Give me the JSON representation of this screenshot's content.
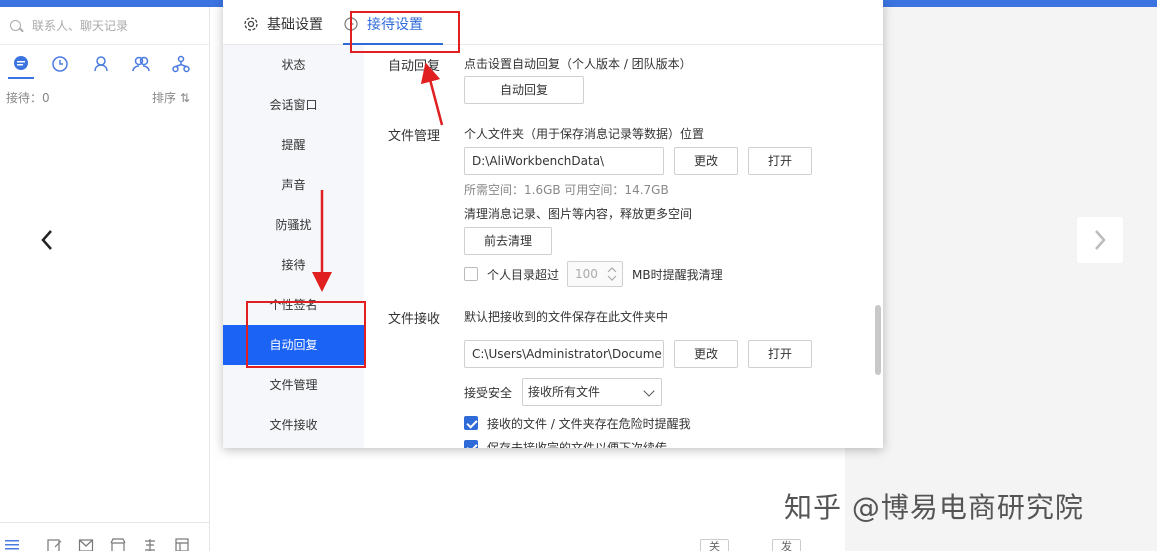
{
  "left_panel": {
    "search_placeholder": "联系人、聊天记录",
    "reception_count": "接待：0",
    "sort_label": "排序 ⇅"
  },
  "dialog": {
    "tabs": [
      {
        "label": "基础设置",
        "icon": "gear-icon"
      },
      {
        "label": "接待设置",
        "icon": "clock-icon",
        "active": true
      }
    ],
    "menu": [
      "状态",
      "会话窗口",
      "提醒",
      "声音",
      "防骚扰",
      "接待",
      "个性签名",
      "自动回复",
      "文件管理",
      "文件接收"
    ],
    "active_menu": "自动回复",
    "auto_reply": {
      "label": "自动回复",
      "desc": "点击设置自动回复（个人版本 / 团队版本）",
      "button": "自动回复"
    },
    "file_management": {
      "label": "文件管理",
      "desc": "个人文件夹（用于保存消息记录等数据）位置",
      "path": "D:\\AliWorkbenchData\\",
      "change_button": "更改",
      "open_button": "打开",
      "space_info": "所需空间：1.6GB    可用空间：14.7GB",
      "clean_desc": "清理消息记录、图片等内容，释放更多空间",
      "clean_button": "前去清理",
      "limit_prefix": "个人目录超过",
      "limit_value": "100",
      "limit_suffix": "MB时提醒我清理"
    },
    "file_receive": {
      "label": "文件接收",
      "desc": "默认把接收到的文件保存在此文件夹中",
      "path": "C:\\Users\\Administrator\\Documents",
      "change_button": "更改",
      "open_button": "打开",
      "security_label": "接受安全",
      "security_value": "接收所有文件",
      "warn_checkbox": "接收的文件 / 文件夹存在危险时提醒我",
      "resume_checkbox": "保存未接收完的文件以便下次续传"
    }
  },
  "chat": {
    "close_button": "关闭",
    "send_button": "发送 ▾"
  },
  "watermark": "知乎 @博易电商研究院",
  "colors": {
    "accent": "#1a63f5",
    "annotation": "#e02020"
  }
}
